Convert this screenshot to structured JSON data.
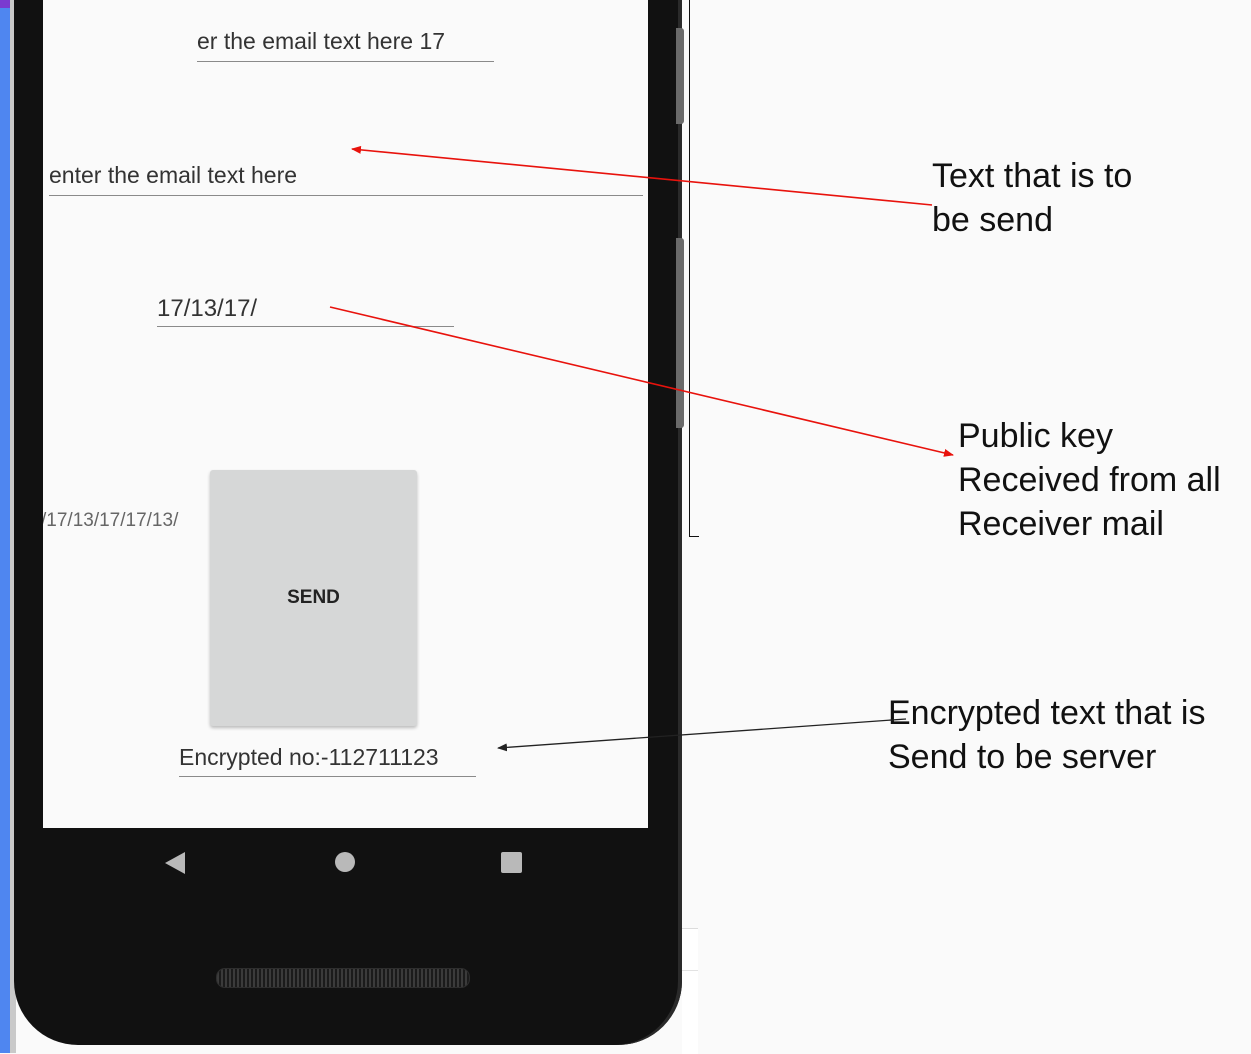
{
  "screen": {
    "fields": {
      "email_field_top": "er the email text here  17",
      "email_text_field": "enter the email text here",
      "public_key_field": "17/13/17/",
      "key_sequence": "/17/13/17/17/13/",
      "send_button": "SEND",
      "encrypted_output": "Encrypted no:-112711123"
    },
    "navbar": {
      "back": "back-icon",
      "home": "home-icon",
      "recent": "recent-apps-icon"
    }
  },
  "annotations": {
    "text_to_send": "Text that is to\nbe send",
    "public_key": "Public key\nReceived from all\nReceiver mail",
    "encrypted_text": "Encrypted text that is\nSend to be server"
  },
  "colors": {
    "arrow_red": "#e8120c",
    "arrow_dark": "#222222",
    "button_bg": "#d6d7d7"
  }
}
